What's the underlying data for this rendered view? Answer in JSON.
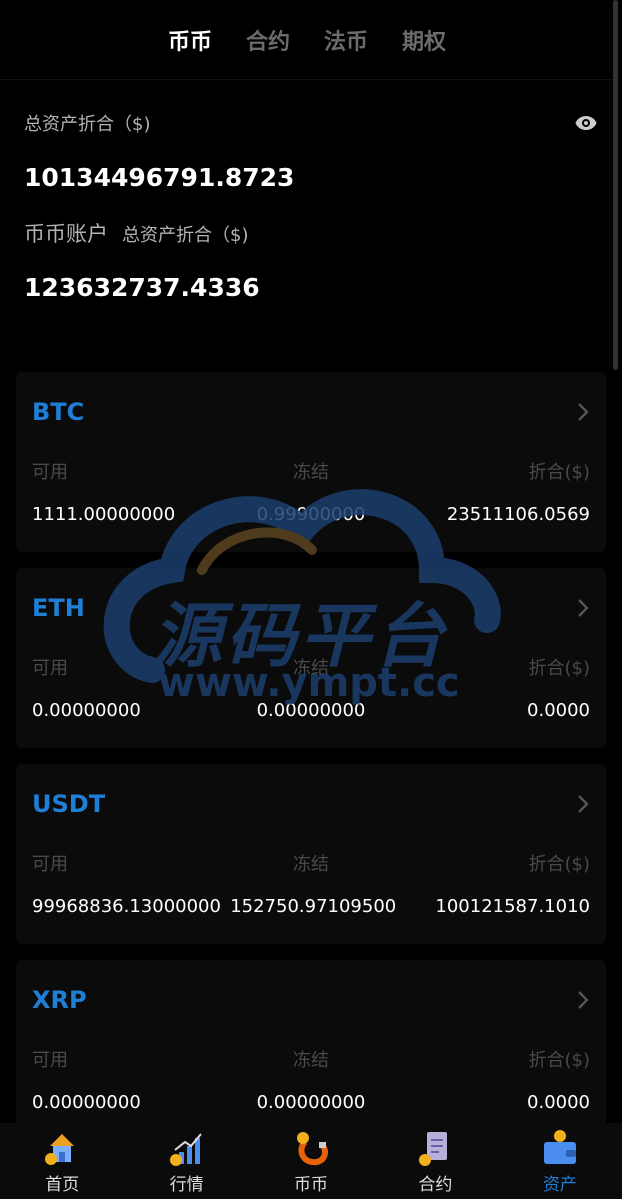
{
  "tabs": [
    {
      "label": "币币",
      "active": true
    },
    {
      "label": "合约",
      "active": false
    },
    {
      "label": "法币",
      "active": false
    },
    {
      "label": "期权",
      "active": false
    }
  ],
  "summary": {
    "total_label": "总资产折合（$)",
    "total_value": "10134496791.8723",
    "account_name": "币币账户",
    "account_sub": "总资产折合（$)",
    "account_value": "123632737.4336"
  },
  "columns": {
    "available": "可用",
    "frozen": "冻结",
    "converted": "折合($)"
  },
  "assets": [
    {
      "coin": "BTC",
      "available": "1111.00000000",
      "frozen": "0.99900000",
      "converted": "23511106.0569"
    },
    {
      "coin": "ETH",
      "available": "0.00000000",
      "frozen": "0.00000000",
      "converted": "0.0000"
    },
    {
      "coin": "USDT",
      "available": "99968836.13000000",
      "frozen": "152750.97109500",
      "converted": "100121587.1010"
    },
    {
      "coin": "XRP",
      "available": "0.00000000",
      "frozen": "0.00000000",
      "converted": "0.0000"
    }
  ],
  "watermark": {
    "text": "源码平台",
    "url": "www.ympt.cc"
  },
  "nav": [
    {
      "label": "首页",
      "icon": "home-icon",
      "active": false
    },
    {
      "label": "行情",
      "icon": "chart-icon",
      "active": false
    },
    {
      "label": "币币",
      "icon": "magnet-icon",
      "active": false
    },
    {
      "label": "合约",
      "icon": "contract-icon",
      "active": false
    },
    {
      "label": "资产",
      "icon": "wallet-icon",
      "active": true
    }
  ],
  "colors": {
    "accent": "#1e7fd6",
    "background": "#000000",
    "card": "#0b0b0b"
  }
}
